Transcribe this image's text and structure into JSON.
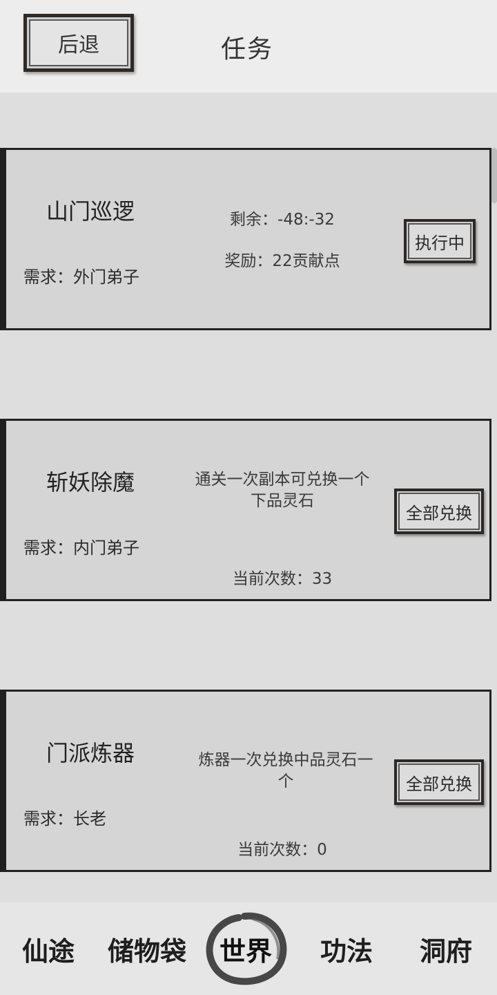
{
  "header": {
    "back_label": "后退",
    "title": "任务"
  },
  "tasks": [
    {
      "title": "山门巡逻",
      "requirement": "需求：外门弟子",
      "info_line1": "剩余：-48:-32",
      "info_line2": "奖励：22贡献点",
      "action_label": "执行中"
    },
    {
      "title": "斩妖除魔",
      "requirement": "需求：内门弟子",
      "description": "通关一次副本可兑换一个下品灵石",
      "count": "当前次数：33",
      "action_label": "全部兑换"
    },
    {
      "title": "门派炼器",
      "requirement": "需求：长老",
      "description": "炼器一次兑换中品灵石一个",
      "count": "当前次数：0",
      "action_label": "全部兑换"
    }
  ],
  "nav": {
    "items": [
      "仙途",
      "储物袋",
      "世界",
      "功法",
      "洞府"
    ],
    "active": "世界"
  }
}
